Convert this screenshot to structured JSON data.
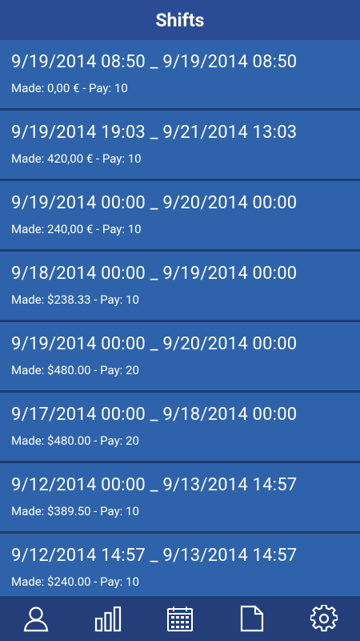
{
  "header": {
    "title": "Shifts"
  },
  "shifts": [
    {
      "range": "9/19/2014 08:50 _ 9/19/2014 08:50",
      "summary": "Made: 0,00 € - Pay: 10"
    },
    {
      "range": "9/19/2014 19:03 _ 9/21/2014 13:03",
      "summary": "Made: 420,00 € - Pay: 10"
    },
    {
      "range": "9/19/2014 00:00 _ 9/20/2014 00:00",
      "summary": "Made: 240,00 € - Pay: 10"
    },
    {
      "range": "9/18/2014 00:00 _ 9/19/2014 00:00",
      "summary": "Made: $238.33 - Pay: 10"
    },
    {
      "range": "9/19/2014 00:00 _ 9/20/2014 00:00",
      "summary": "Made: $480.00 - Pay: 20"
    },
    {
      "range": "9/17/2014 00:00 _ 9/18/2014 00:00",
      "summary": "Made: $480.00 - Pay: 20"
    },
    {
      "range": "9/12/2014 00:00 _ 9/13/2014 14:57",
      "summary": "Made: $389.50 - Pay: 10"
    },
    {
      "range": "9/12/2014 14:57 _ 9/13/2014 14:57",
      "summary": "Made: $240.00 - Pay: 10"
    }
  ],
  "tabs": [
    {
      "icon": "user-icon"
    },
    {
      "icon": "bar-chart-icon"
    },
    {
      "icon": "calendar-icon"
    },
    {
      "icon": "document-icon"
    },
    {
      "icon": "gear-icon"
    }
  ],
  "colors": {
    "header_bg": "#2b4c94",
    "item_bg": "#2e63ab",
    "divider": "#1e3a73",
    "tabbar_bg": "#233e78"
  }
}
